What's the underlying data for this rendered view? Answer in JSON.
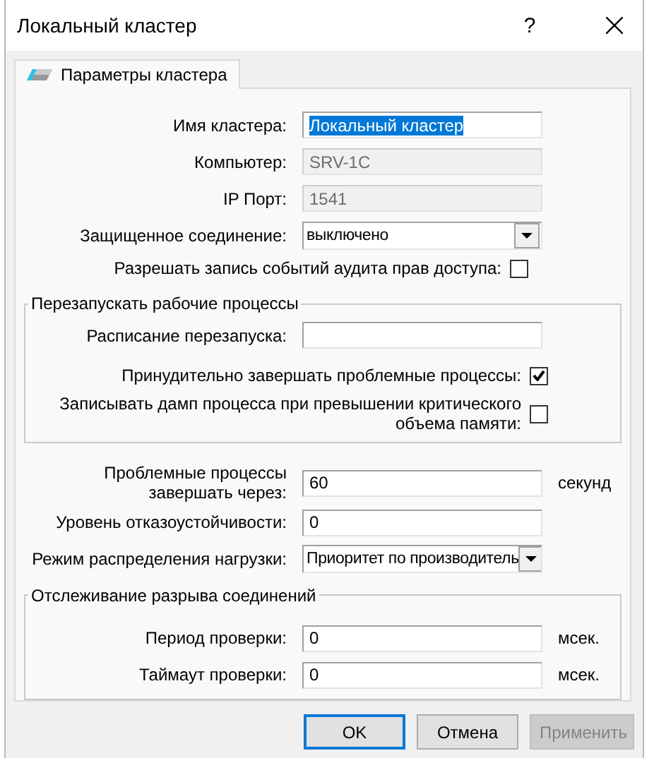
{
  "window": {
    "title": "Локальный кластер",
    "help": "?"
  },
  "tabs": [
    {
      "label": "Параметры кластера",
      "selected": true
    }
  ],
  "general": [
    {
      "kind": "text",
      "label": "Имя кластера:",
      "value": "Локальный кластер",
      "highlighted": true
    },
    {
      "kind": "readonly",
      "label": "Компьютер:",
      "value": "SRV-1C"
    },
    {
      "kind": "readonly",
      "label": "IP Порт:",
      "value": "1541"
    },
    {
      "kind": "combo",
      "label": "Защищенное соединение:",
      "value": "выключено"
    },
    {
      "kind": "checkbox",
      "label": "Разрешать запись событий аудита прав доступа:",
      "checked": false
    }
  ],
  "restart_group": {
    "title": "Перезапускать рабочие процессы",
    "rows": [
      {
        "kind": "text",
        "label": "Расписание перезапуска:"
      },
      {
        "kind": "checkbox",
        "label": "Принудительно завершать проблемные процессы:",
        "checked": true
      },
      {
        "kind": "checkbox",
        "label": "Записывать дамп процесса при превышении критического объема памяти:",
        "checked": false
      }
    ]
  },
  "process_settings": [
    {
      "kind": "text",
      "label": "Проблемные процессы завершать через:",
      "value": "60",
      "unit": "секунд"
    },
    {
      "kind": "text",
      "label": "Уровень отказоустойчивости:",
      "value": "0"
    },
    {
      "kind": "combo",
      "label": "Режим распределения нагрузки:",
      "value": "Приоритет по производитель"
    }
  ],
  "connection_group": {
    "title": "Отслеживание разрыва соединений",
    "rows": [
      {
        "kind": "text",
        "label": "Период проверки:",
        "value": "0",
        "unit": "мсек."
      },
      {
        "kind": "text",
        "label": "Таймаут проверки:",
        "value": "0",
        "unit": "мсек."
      }
    ]
  },
  "buttons": [
    {
      "label": "OK",
      "default": true,
      "disabled": false
    },
    {
      "label": "Отмена",
      "default": false,
      "disabled": false
    },
    {
      "label": "Применить",
      "default": false,
      "disabled": true
    }
  ]
}
